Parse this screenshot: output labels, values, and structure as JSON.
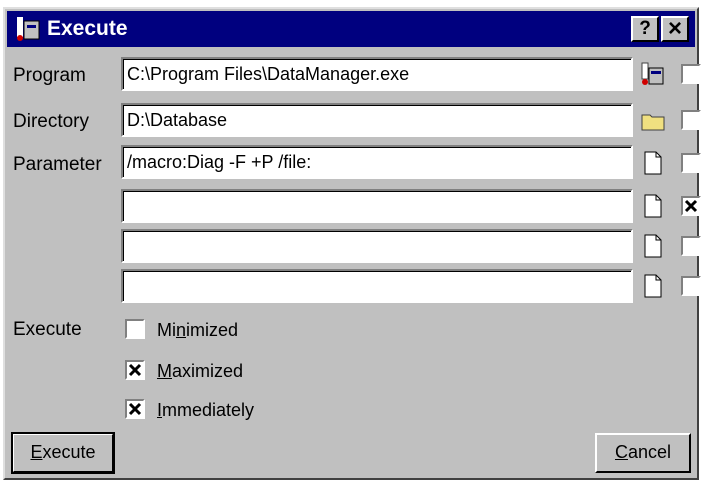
{
  "window": {
    "title": "Execute",
    "help_label": "?",
    "close_label": "×"
  },
  "program": {
    "label": "Program",
    "value": "C:\\Program Files\\DataManager.exe",
    "checked": false
  },
  "directory": {
    "label": "Directory",
    "value": "D:\\Database",
    "checked": false
  },
  "parameter": {
    "label": "Parameter",
    "rows": [
      {
        "value": "/macro:Diag -F +P /file:",
        "checked": false
      },
      {
        "value": "",
        "checked": true
      },
      {
        "value": "",
        "checked": false
      },
      {
        "value": "",
        "checked": false
      }
    ]
  },
  "execute": {
    "label": "Execute",
    "options": [
      {
        "label": "Minimized",
        "checked": false
      },
      {
        "label": "Maximized",
        "checked": true
      },
      {
        "label": "Immediately",
        "checked": true
      }
    ]
  },
  "buttons": {
    "execute": "Execute",
    "cancel": "Cancel"
  },
  "colors": {
    "titlebar": "#00007f",
    "face": "#c0c0c0",
    "folder": "#f0e080"
  }
}
